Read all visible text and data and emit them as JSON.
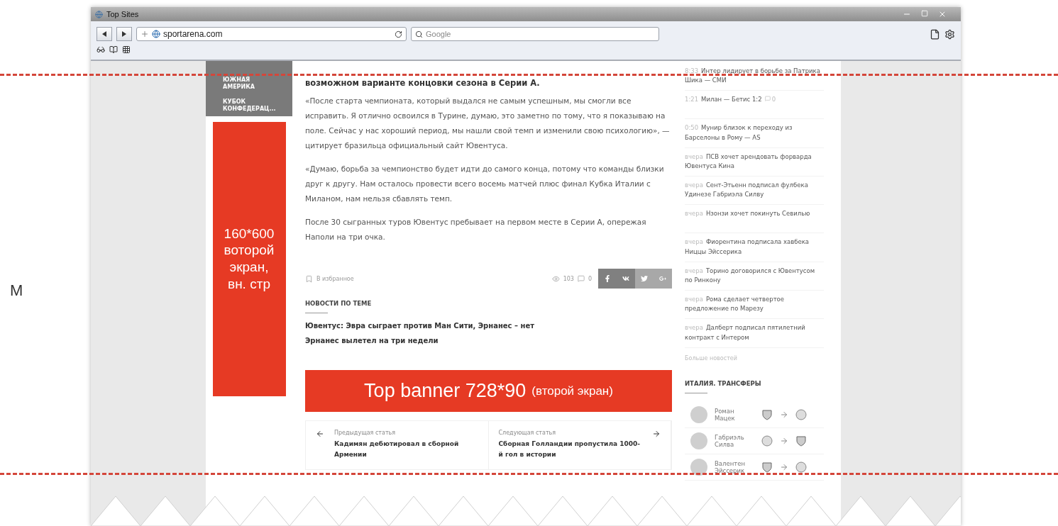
{
  "side_note": "М",
  "window": {
    "title": "Top Sites"
  },
  "toolbar": {
    "url": "sportarena.com",
    "search_placeholder": "Google"
  },
  "nav": [
    {
      "label": "ЮЖНАЯ АМЕРИКА"
    },
    {
      "label": "КУБОК КОНФЕДЕРАЦ..."
    }
  ],
  "side_ad": {
    "lines": [
      "160*600",
      "воторой",
      "экран,",
      "вн. стр"
    ]
  },
  "article": {
    "headline_tail": "возможном варианте концовки сезона в Серии А.",
    "paragraphs": [
      "«После старта чемпионата, который выдался не самым успешным, мы смогли все исправить. Я отлично освоился в Турине, думаю, это заметно по тому, что я показываю на поле. Сейчас у нас хороший период, мы нашли свой темп и изменили свою психологию», — цитирует бразильца официальный сайт Ювентуса.",
      "«Думаю, борьба за чемпионство будет идти до самого конца, потому что команды близки друг к другу. Нам осталось провести всего восемь матчей плюс финал Кубка Италии с Миланом, нам нельзя сбавлять темп.",
      "После 30 сыгранных туров Ювентус пребывает на первом месте в Серии А, опережая Наполи на три очка."
    ],
    "favorite": "В избранное",
    "views": "103",
    "comments": "0",
    "share": [
      {
        "kind": "facebook"
      },
      {
        "kind": "vk"
      },
      {
        "kind": "twitter"
      },
      {
        "kind": "gplus"
      }
    ]
  },
  "related": {
    "heading": "НОВОСТИ ПО ТЕМЕ",
    "links": [
      "Ювентус: Эвра сыграет против Ман Сити, Эрнанес – нет",
      "Эрнанес вылетел на три недели"
    ]
  },
  "banner": {
    "main": "Top banner 728*90",
    "note": "(второй экран)"
  },
  "pager": [
    {
      "kind": "prev",
      "label": "Предыдущая статья",
      "title": "Кадимян дебютировал в сборной Армении"
    },
    {
      "kind": "next",
      "label": "Следующая статья",
      "title": "Сборная Голландии пропустила 1000-й гол в истории"
    }
  ],
  "news": [
    {
      "time": "8:33",
      "title": "Интер лидирует в борьбе за Патрика Шика — СМИ"
    },
    {
      "time": "1:21",
      "title": "Милан — Бетис 1:2",
      "comments": "0"
    },
    {
      "time": "0:50",
      "title": "Мунир близок к переходу из Барселоны в Рому — AS"
    },
    {
      "time": "вчера",
      "title": "ПСВ хочет арендовать форварда Ювентуса Кина"
    },
    {
      "time": "вчера",
      "title": "Сент-Этьенн подписал фулбека Удинезе Габриэла Силву"
    },
    {
      "time": "вчера",
      "title": "Нзонзи хочет покинуть Севилью"
    },
    {
      "time": "вчера",
      "title": "Фиорентина подписала хавбека Ниццы Эйссерика"
    },
    {
      "time": "вчера",
      "title": "Торино договорился с Ювентусом по Ринкону"
    },
    {
      "time": "вчера",
      "title": "Рома сделает четвертое предложение по Марезу"
    },
    {
      "time": "вчера",
      "title": "Далберт подписал пятилетний контракт с Интером"
    }
  ],
  "more_news": "Больше новостей",
  "transfers": {
    "heading": "ИТАЛИЯ. ТРАНСФЕРЫ",
    "rows": [
      {
        "name": "Роман Мацек"
      },
      {
        "name": "Габриэль Силва"
      },
      {
        "name": "Валентен Эйссерик"
      }
    ]
  }
}
